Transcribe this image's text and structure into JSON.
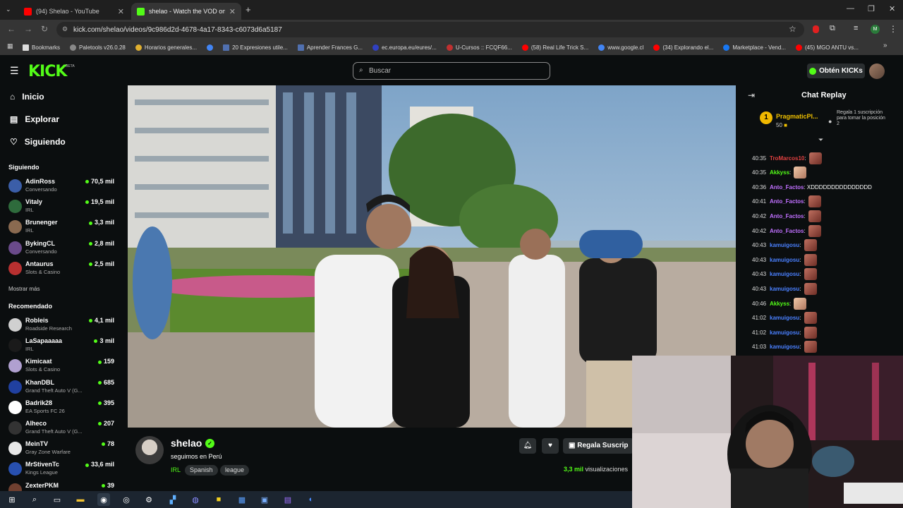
{
  "browser": {
    "tabs": [
      {
        "title": "(94) Shelao - YouTube",
        "active": false
      },
      {
        "title": "shelao - Watch the VOD on",
        "active": true
      }
    ],
    "url": "kick.com/shelao/videos/9c986d2d-4678-4a17-8343-c6073d6a5187",
    "bookmarks": [
      "Bookmarks",
      "Paletools v26.0.28",
      "Horarios generales...",
      "",
      "20 Expresiones utile...",
      "Aprender Frances G...",
      "ec.europa.eu/eures/...",
      "U-Cursos :: FCQF66...",
      "(58) Real Life Trick S...",
      "www.google.cl",
      "(34) Explorando el...",
      "Marketplace - Vend...",
      "(45) MGO ANTU vs..."
    ]
  },
  "header": {
    "logo": "KICK",
    "beta": "BETA",
    "search_placeholder": "Buscar",
    "get_kicks": "Obtén KICKs"
  },
  "sidebar": {
    "nav": [
      "Inicio",
      "Explorar",
      "Siguiendo"
    ],
    "following_title": "Siguiendo",
    "following": [
      {
        "name": "AdinRoss",
        "category": "Conversando",
        "viewers": "70,5 mil",
        "color": "#3b5ea8"
      },
      {
        "name": "Vitaly",
        "category": "IRL",
        "viewers": "19,5 mil",
        "color": "#2e6b3c"
      },
      {
        "name": "Brunenger",
        "category": "IRL",
        "viewers": "3,3 mil",
        "color": "#8a6a50"
      },
      {
        "name": "BykingCL",
        "category": "Conversando",
        "viewers": "2,8 mil",
        "color": "#6a4a8a"
      },
      {
        "name": "Antaurus",
        "category": "Slots & Casino",
        "viewers": "2,5 mil",
        "color": "#b83030"
      }
    ],
    "show_more": "Mostrar más",
    "recommended_title": "Recomendado",
    "recommended": [
      {
        "name": "Robleis",
        "category": "Roadside Research",
        "viewers": "4,1 mil",
        "color": "#d0d0d0"
      },
      {
        "name": "LaSapaaaaa",
        "category": "IRL",
        "viewers": "3 mil",
        "color": "#1a1a1a"
      },
      {
        "name": "Kimicaat",
        "category": "Slots & Casino",
        "viewers": "159",
        "color": "#b0a0d0"
      },
      {
        "name": "KhanDBL",
        "category": "Grand Theft Auto V (G...",
        "viewers": "685",
        "color": "#2040a0"
      },
      {
        "name": "Badrik28",
        "category": "EA Sports FC 26",
        "viewers": "395",
        "color": "#ffffff"
      },
      {
        "name": "Alheco",
        "category": "Grand Theft Auto V (G...",
        "viewers": "207",
        "color": "#333333"
      },
      {
        "name": "MeinTV",
        "category": "Gray Zone Warfare",
        "viewers": "78",
        "color": "#e8e8e8"
      },
      {
        "name": "MrStivenTc",
        "category": "Kings League",
        "viewers": "33,6 mil",
        "color": "#2850b0"
      },
      {
        "name": "ZexterPKM",
        "category": "",
        "viewers": "39",
        "color": "#704030"
      }
    ]
  },
  "stream": {
    "name": "shelao",
    "title": "seguimos en Perú",
    "category": "IRL",
    "tags": [
      "Spanish",
      "league"
    ],
    "subscribe_label": "Regala Suscrip",
    "viewers_count": "3,3 mil",
    "viewers_label": "visualizaciones"
  },
  "chat": {
    "title": "Chat Replay",
    "pinned_user": "PragmaticPl...",
    "pinned_count": "50",
    "pinned_rank": "1",
    "pinned_note": "Regala 1 suscripción para tomar la posición 2",
    "messages": [
      {
        "time": "40:35",
        "user": "TroMarcos10",
        "color": "#e04040",
        "msg": "",
        "emote": true
      },
      {
        "time": "40:35",
        "user": "Akkyss",
        "color": "#53fc18",
        "msg": "",
        "emote": true
      },
      {
        "time": "40:36",
        "user": "Anto_Factos",
        "color": "#c070ff",
        "msg": "XDDDDDDDDDDDDDDD",
        "emote": false
      },
      {
        "time": "40:41",
        "user": "Anto_Factos",
        "color": "#c070ff",
        "msg": "",
        "emote": true
      },
      {
        "time": "40:42",
        "user": "Anto_Factos",
        "color": "#c070ff",
        "msg": "",
        "emote": true
      },
      {
        "time": "40:42",
        "user": "Anto_Factos",
        "color": "#c070ff",
        "msg": "",
        "emote": true
      },
      {
        "time": "40:43",
        "user": "kamuigosu",
        "color": "#4a80ff",
        "msg": "",
        "emote": true
      },
      {
        "time": "40:43",
        "user": "kamuigosu",
        "color": "#4a80ff",
        "msg": "",
        "emote": true
      },
      {
        "time": "40:43",
        "user": "kamuigosu",
        "color": "#4a80ff",
        "msg": "",
        "emote": true
      },
      {
        "time": "40:43",
        "user": "kamuigosu",
        "color": "#4a80ff",
        "msg": "",
        "emote": true
      },
      {
        "time": "40:46",
        "user": "Akkyss",
        "color": "#53fc18",
        "msg": "",
        "emote": true
      },
      {
        "time": "41:02",
        "user": "kamuigosu",
        "color": "#4a80ff",
        "msg": "",
        "emote": true
      },
      {
        "time": "41:02",
        "user": "kamuigosu",
        "color": "#4a80ff",
        "msg": "",
        "emote": true
      },
      {
        "time": "41:03",
        "user": "kamuigosu",
        "color": "#4a80ff",
        "msg": "",
        "emote": true
      }
    ]
  },
  "theme": {
    "accent": "#53fc18",
    "background": "#0b0e0f"
  }
}
